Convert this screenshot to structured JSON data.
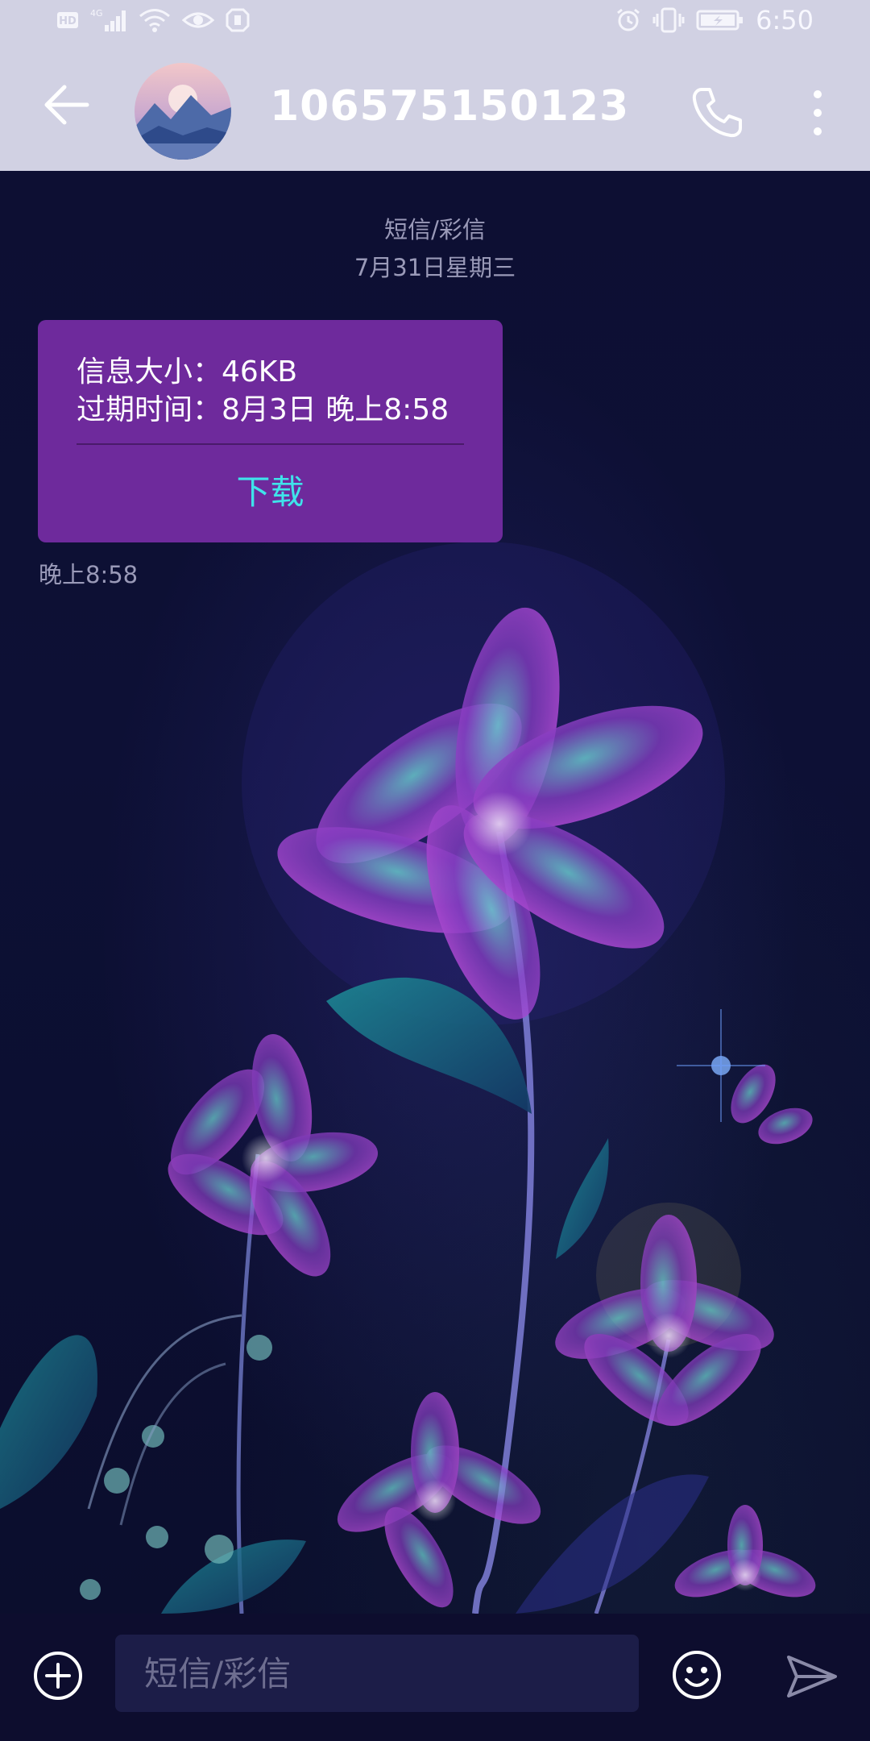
{
  "status_bar": {
    "time": "6:50",
    "left_icons": [
      "hd-icon",
      "4g-signal-icon",
      "wifi-icon",
      "eye-icon",
      "shield-icon"
    ],
    "right_icons": [
      "alarm-icon",
      "vibrate-icon",
      "battery-charging-icon"
    ]
  },
  "header": {
    "contact_name": "106575150123",
    "background": "#d1d1e3"
  },
  "conversation": {
    "type_label": "短信/彩信",
    "date_label": "7月31日星期三"
  },
  "mms_card": {
    "size_line": "信息大小：46KB",
    "expiry_line": "过期时间：8月3日 晚上8:58",
    "download_label": "下载",
    "time": "晚上8:58",
    "background": "#6e2a9c",
    "accent": "#3fe3ea"
  },
  "input_bar": {
    "placeholder": "短信/彩信"
  }
}
